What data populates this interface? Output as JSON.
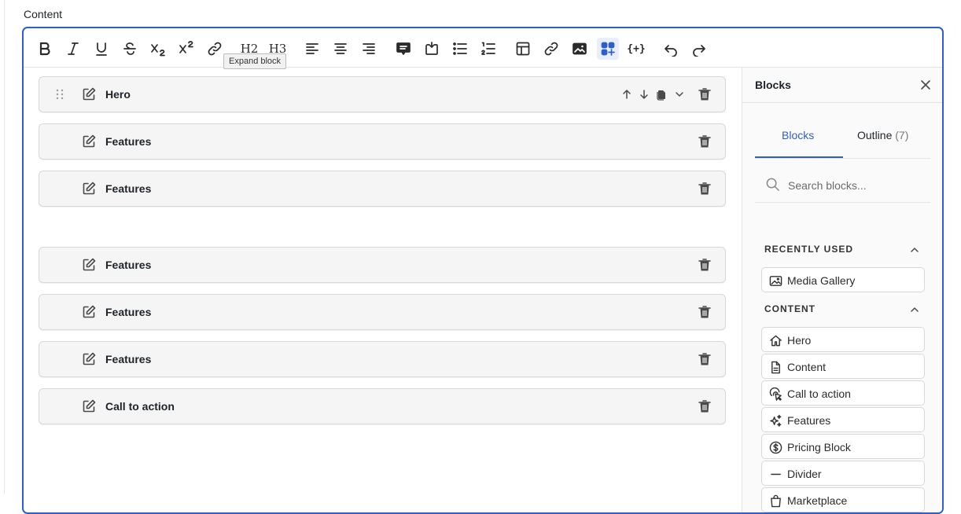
{
  "field": {
    "label": "Content"
  },
  "toolbar": {
    "tooltip": "Expand block",
    "h2": "H2",
    "h3": "H3",
    "code_block": "{+}"
  },
  "blocks": [
    {
      "label": "Hero",
      "selected": true
    },
    {
      "label": "Features"
    },
    {
      "label": "Features"
    },
    {
      "label": "Features"
    },
    {
      "label": "Features"
    },
    {
      "label": "Features"
    },
    {
      "label": "Call to action"
    }
  ],
  "sidebar": {
    "title": "Blocks",
    "tabs": [
      {
        "label": "Blocks",
        "active": true
      },
      {
        "label": "Outline",
        "count": "(7)"
      }
    ],
    "search_placeholder": "Search blocks...",
    "recent": {
      "title": "RECENTLY USED",
      "items": [
        {
          "label": "Media Gallery",
          "icon": "image-icon"
        }
      ]
    },
    "content": {
      "title": "CONTENT",
      "items": [
        {
          "label": "Hero",
          "icon": "home-icon"
        },
        {
          "label": "Content",
          "icon": "document-icon"
        },
        {
          "label": "Call to action",
          "icon": "pointer-click-icon"
        },
        {
          "label": "Features",
          "icon": "sparkles-icon"
        },
        {
          "label": "Pricing Block",
          "icon": "dollar-circle-icon"
        },
        {
          "label": "Divider",
          "icon": "minus-icon"
        },
        {
          "label": "Marketplace",
          "icon": "shopping-bag-icon"
        }
      ]
    }
  },
  "colors": {
    "accent": "#2f5fc4",
    "block_bg": "#f5f5f5",
    "sidebar_bg": "#fafafa"
  }
}
